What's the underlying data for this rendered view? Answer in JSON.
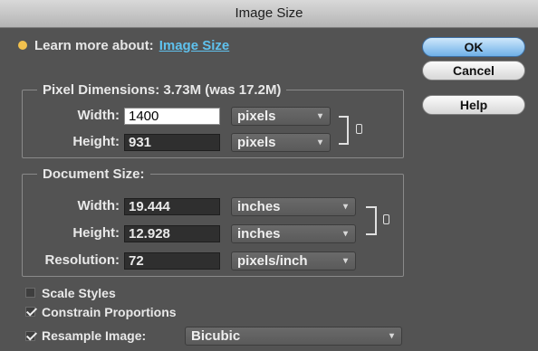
{
  "window": {
    "title": "Image Size"
  },
  "learn": {
    "prefix": "Learn more about:",
    "link": "Image Size"
  },
  "buttons": {
    "ok": "OK",
    "cancel": "Cancel",
    "help": "Help"
  },
  "pixel_dimensions": {
    "legend": "Pixel Dimensions:  3.73M (was 17.2M)",
    "width_label": "Width:",
    "width_value": "1400",
    "width_unit": "pixels",
    "height_label": "Height:",
    "height_value": "931",
    "height_unit": "pixels"
  },
  "document_size": {
    "legend": "Document Size:",
    "width_label": "Width:",
    "width_value": "19.444",
    "width_unit": "inches",
    "height_label": "Height:",
    "height_value": "12.928",
    "height_unit": "inches",
    "resolution_label": "Resolution:",
    "resolution_value": "72",
    "resolution_unit": "pixels/inch"
  },
  "options": {
    "scale_styles": {
      "label": "Scale Styles",
      "checked": false
    },
    "constrain": {
      "label": "Constrain Proportions",
      "checked": true
    },
    "resample": {
      "label": "Resample Image:",
      "checked": true,
      "method": "Bicubic"
    }
  },
  "colors": {
    "dialog_bg": "#535353",
    "link": "#5fc2ee",
    "ok_button": "#6fb0e8"
  }
}
